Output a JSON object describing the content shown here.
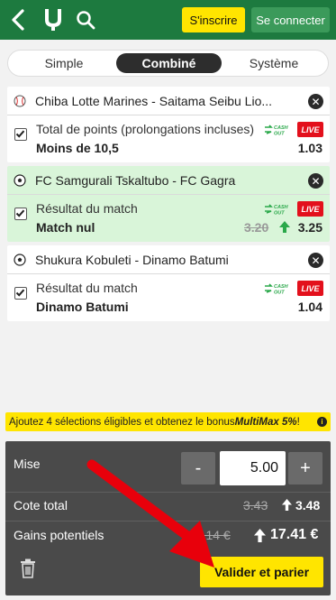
{
  "header": {
    "signup_label": "S'inscrire",
    "login_label": "Se connecter",
    "brand_color": "#1d7a3f",
    "accent_color": "#ffe500"
  },
  "tabs": [
    {
      "label": "Simple",
      "active": false
    },
    {
      "label": "Combiné",
      "active": true
    },
    {
      "label": "Système",
      "active": false
    }
  ],
  "bets": [
    {
      "event": "Chiba Lotte Marines - Saitama Seibu Lio...",
      "sport_icon": "baseball-icon",
      "market": "Total de points (prolongations incluses)",
      "selection": "Moins de 10,5",
      "odds": "1.03",
      "old_odds": "",
      "highlighted": false,
      "cashout": "CASH OUT",
      "live": "LIVE"
    },
    {
      "event": "FC Samgurali Tskaltubo - FC Gagra",
      "sport_icon": "soccer-ball-icon",
      "market": "Résultat du match",
      "selection": "Match nul",
      "odds": "3.25",
      "old_odds": "3.20",
      "highlighted": true,
      "cashout": "CASH OUT",
      "live": "LIVE"
    },
    {
      "event": "Shukura Kobuleti - Dinamo Batumi",
      "sport_icon": "soccer-ball-icon",
      "market": "Résultat du match",
      "selection": "Dinamo Batumi",
      "odds": "1.04",
      "old_odds": "",
      "highlighted": false,
      "cashout": "CASH OUT",
      "live": "LIVE"
    }
  ],
  "multimax": {
    "text_prefix": "Ajoutez 4 sélections éligibles et obtenez le bonus ",
    "text_bonus": "MultiMax 5%",
    "text_suffix": " !",
    "info": "i"
  },
  "slip": {
    "stake_label": "Mise",
    "stake_value": "5.00",
    "minus": "-",
    "plus": "+",
    "total_odds_label": "Cote total",
    "total_odds_old": "3.43",
    "total_odds_new": "3.48",
    "winnings_label": "Gains potentiels",
    "winnings_old": "17.14 €",
    "winnings_new": "17.41 €",
    "validate_label": "Valider et parier"
  },
  "colors": {
    "highlight_row": "#d9f5d9",
    "live_red": "#e3101c",
    "odds_up_green": "#2aa84a",
    "annotation_red": "#e8000b"
  }
}
